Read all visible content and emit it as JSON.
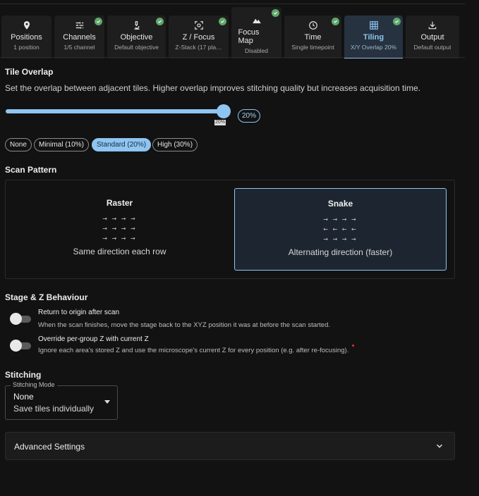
{
  "tabs": [
    {
      "label": "Positions",
      "sub": "1 position",
      "icon": "pin-icon",
      "checked": false
    },
    {
      "label": "Channels",
      "sub": "1/5 channel",
      "icon": "sliders-icon",
      "checked": true
    },
    {
      "label": "Objective",
      "sub": "Default objective",
      "icon": "microscope-icon",
      "checked": true
    },
    {
      "label": "Z / Focus",
      "sub": "Z-Stack (17 pla…",
      "icon": "focus-icon",
      "checked": true
    },
    {
      "label": "Focus Map",
      "sub": "Disabled",
      "icon": "mountain-icon",
      "checked": true
    },
    {
      "label": "Time",
      "sub": "Single timepoint",
      "icon": "clock-icon",
      "checked": true
    },
    {
      "label": "Tiling",
      "sub": "X/Y Overlap 20%",
      "icon": "grid-icon",
      "checked": true
    },
    {
      "label": "Output",
      "sub": "Default output",
      "icon": "download-icon",
      "checked": false
    }
  ],
  "tile_overlap": {
    "title": "Tile Overlap",
    "description": "Set the overlap between adjacent tiles. Higher overlap improves stitching quality but increases acquisition time.",
    "value_label": "20%",
    "value_fraction": 0.2,
    "tick_label": "20%",
    "presets": [
      "None",
      "Minimal (10%)",
      "Standard (20%)",
      "High (30%)"
    ],
    "selected_preset": "Standard (20%)"
  },
  "scan_pattern": {
    "title": "Scan Pattern",
    "options": [
      {
        "name": "Raster",
        "description": "Same direction each row",
        "rows": [
          "→ → → →",
          "→ → → →",
          "→ → → →"
        ]
      },
      {
        "name": "Snake",
        "description": "Alternating direction (faster)",
        "rows": [
          "→ → → →",
          "← ← ← ←",
          "→ → → →"
        ]
      }
    ],
    "selected": "Snake"
  },
  "stage": {
    "title": "Stage & Z Behaviour",
    "toggles": [
      {
        "label": "Return to origin after scan",
        "description": "When the scan finishes, move the stage back to the XYZ position it was at before the scan started.",
        "on": false
      },
      {
        "label": "Override per-group Z with current Z",
        "description": "Ignore each area's stored Z and use the microscope's current Z for every position (e.g. after re-focusing).",
        "on": false
      }
    ]
  },
  "stitching": {
    "title": "Stitching",
    "mode_label": "Stitching Mode",
    "mode_value": "None",
    "mode_detail": "Save tiles individually"
  },
  "advanced": {
    "label": "Advanced Settings"
  },
  "colors": {
    "accent": "#8ec5f2",
    "check": "#5fa86b",
    "background": "#121212"
  }
}
